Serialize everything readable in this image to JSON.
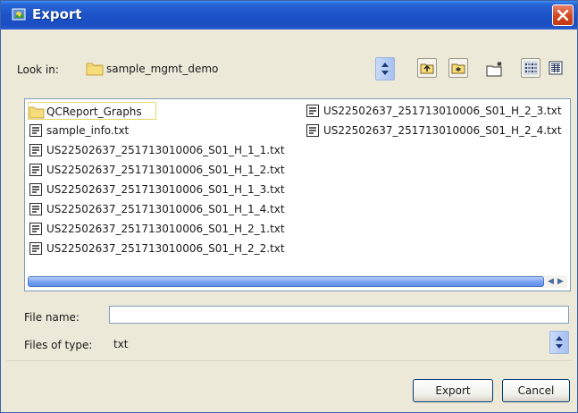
{
  "window": {
    "title": "Export",
    "close_glyph": "×"
  },
  "look_in": {
    "label": "Look in:",
    "value": "sample_mgmt_demo"
  },
  "toolbar": {
    "icons": [
      "up-one-level-icon",
      "desktop-icon",
      "new-folder-icon",
      "list-view-icon",
      "details-view-icon"
    ]
  },
  "files": {
    "column1": [
      {
        "name": "QCReport_Graphs",
        "kind": "folder"
      },
      {
        "name": "sample_info.txt",
        "kind": "file"
      },
      {
        "name": "US22502637_251713010006_S01_H_1_1.txt",
        "kind": "file"
      },
      {
        "name": "US22502637_251713010006_S01_H_1_2.txt",
        "kind": "file"
      },
      {
        "name": "US22502637_251713010006_S01_H_1_3.txt",
        "kind": "file"
      },
      {
        "name": "US22502637_251713010006_S01_H_1_4.txt",
        "kind": "file"
      },
      {
        "name": "US22502637_251713010006_S01_H_2_1.txt",
        "kind": "file"
      },
      {
        "name": "US22502637_251713010006_S01_H_2_2.txt",
        "kind": "file"
      }
    ],
    "column2": [
      {
        "name": "US22502637_251713010006_S01_H_2_3.txt",
        "kind": "file"
      },
      {
        "name": "US22502637_251713010006_S01_H_2_4.txt",
        "kind": "file"
      }
    ]
  },
  "file_name": {
    "label": "File name:",
    "value": ""
  },
  "file_type": {
    "label": "Files of type:",
    "value": "txt"
  },
  "buttons": {
    "export": "Export",
    "cancel": "Cancel"
  },
  "colors": {
    "title_bar": "#1c52c9",
    "close_button": "#d3461f",
    "dialog_bg": "#ece9d8",
    "scroll_thumb": "#7aa4f1"
  }
}
